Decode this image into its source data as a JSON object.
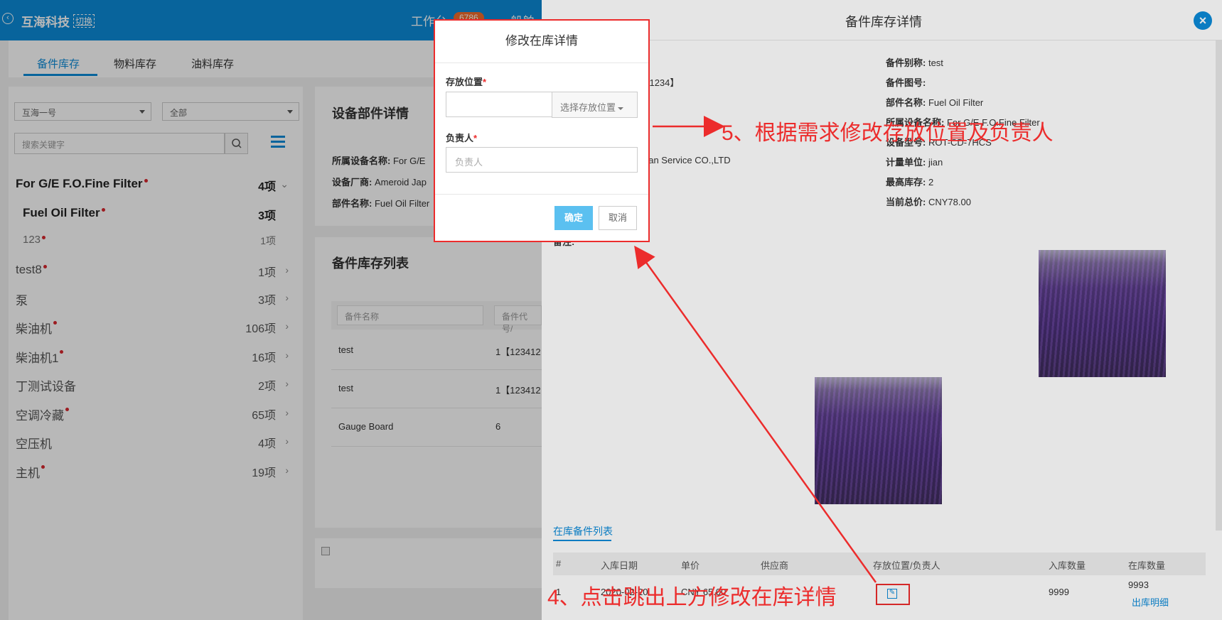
{
  "topbar": {
    "brand": "互海科技",
    "switch": "切换",
    "center": "工作台",
    "badge": "6786",
    "center2": "船舶"
  },
  "tabs": [
    "备件库存",
    "物料库存",
    "油料库存"
  ],
  "filters": {
    "ship": "互海一号",
    "scope": "全部",
    "search_placeholder": "搜索关键字"
  },
  "tree": [
    {
      "label": "For G/E F.O.Fine Filter",
      "count": "4项",
      "dot": true,
      "bold": true,
      "chev": "⌄"
    },
    {
      "label": "Fuel Oil Filter",
      "count": "3项",
      "dot": true,
      "bold": true,
      "chev": ""
    },
    {
      "label": "123",
      "count": "1项",
      "dot": true,
      "bold": false,
      "chev": ""
    },
    {
      "label": "test8",
      "count": "1项",
      "dot": true,
      "bold": false,
      "chev": "›"
    },
    {
      "label": "泵",
      "count": "3项",
      "dot": false,
      "bold": false,
      "chev": "›"
    },
    {
      "label": "柴油机",
      "count": "106项",
      "dot": true,
      "bold": false,
      "chev": "›"
    },
    {
      "label": "柴油机1",
      "count": "16项",
      "dot": true,
      "bold": false,
      "chev": "›"
    },
    {
      "label": "丁测试设备",
      "count": "2项",
      "dot": false,
      "bold": false,
      "chev": "›"
    },
    {
      "label": "空调冷藏",
      "count": "65项",
      "dot": true,
      "bold": false,
      "chev": "›"
    },
    {
      "label": "空压机",
      "count": "4项",
      "dot": false,
      "bold": false,
      "chev": "›"
    },
    {
      "label": "主机",
      "count": "19项",
      "dot": true,
      "bold": false,
      "chev": "›"
    }
  ],
  "detail_card": {
    "title": "设备部件详情",
    "rows": [
      {
        "k": "所属设备名称:",
        "v": "For G/E"
      },
      {
        "k": "设备厂商:",
        "v": "Ameroid Jap"
      },
      {
        "k": "部件名称:",
        "v": "Fuel Oil Filter"
      }
    ]
  },
  "list_card": {
    "title": "备件库存列表",
    "col1_placeholder": "备件名称",
    "col2_placeholder": "备件代号/",
    "rows": [
      {
        "name": "test",
        "code": "1【123412"
      },
      {
        "name": "test",
        "code": "1【123412"
      },
      {
        "name": "Gauge Board",
        "code": "6"
      }
    ]
  },
  "drawer": {
    "title": "备件库存详情",
    "close": "×",
    "left_fragments": [
      "341234】",
      "pan Service CO.,LTD",
      "备注:"
    ],
    "fields": [
      {
        "k": "备件别称:",
        "v": "test"
      },
      {
        "k": "备件图号:",
        "v": ""
      },
      {
        "k": "部件名称:",
        "v": "Fuel Oil Filter"
      },
      {
        "k": "所属设备名称:",
        "v": "For G/E F.O.Fine Filter"
      },
      {
        "k": "设备型号:",
        "v": "ROT-CD-7HCS"
      },
      {
        "k": "计量单位:",
        "v": "jian"
      },
      {
        "k": "最高库存:",
        "v": "2"
      },
      {
        "k": "当前总价:",
        "v": "CNY78.00"
      }
    ],
    "inlist_tab": "在库备件列表",
    "table_headers": [
      "#",
      "入库日期",
      "单价",
      "供应商",
      "存放位置/负责人",
      "入库数量",
      "在库数量"
    ],
    "row": {
      "idx": "1",
      "date": "2020-02-20",
      "price": "CNY 65.00",
      "in_qty": "9999",
      "stock": "9993",
      "link": "出库明细"
    }
  },
  "modal": {
    "title": "修改在库详情",
    "location_label": "存放位置",
    "location_dropdown": "选择存放位置",
    "owner_label": "负责人",
    "owner_placeholder": "负责人",
    "ok": "确定",
    "cancel": "取消"
  },
  "annotations": {
    "step5": "5、根据需求修改存放位置及负责人",
    "step4": "4、点击跳出上方修改在库详情"
  }
}
